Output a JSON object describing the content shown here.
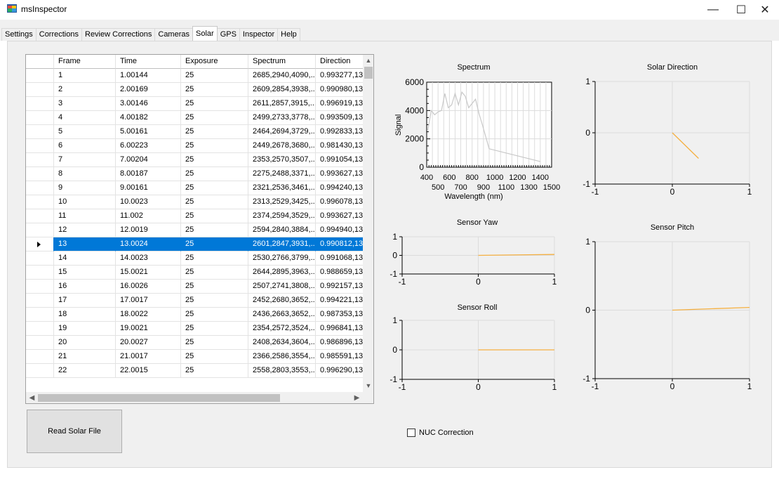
{
  "window": {
    "title": "msInspector",
    "minimize": "—",
    "maximize": "☐",
    "close": "✕"
  },
  "tabs": [
    "Settings",
    "Corrections",
    "Review Corrections",
    "Cameras",
    "Solar",
    "GPS",
    "Inspector",
    "Help"
  ],
  "active_tab": "Solar",
  "grid": {
    "columns": [
      "",
      "Frame",
      "Time",
      "Exposure",
      "Spectrum",
      "Direction"
    ],
    "selected_frame": "13",
    "rows": [
      [
        "1",
        "1.00144",
        "25",
        "2685,2940,4090,...",
        "0.993277,13"
      ],
      [
        "2",
        "2.00169",
        "25",
        "2609,2854,3938,...",
        "0.990980,13"
      ],
      [
        "3",
        "3.00146",
        "25",
        "2611,2857,3915,...",
        "0.996919,13"
      ],
      [
        "4",
        "4.00182",
        "25",
        "2499,2733,3778,...",
        "0.993509,13"
      ],
      [
        "5",
        "5.00161",
        "25",
        "2464,2694,3729,...",
        "0.992833,13"
      ],
      [
        "6",
        "6.00223",
        "25",
        "2449,2678,3680,...",
        "0.981430,13"
      ],
      [
        "7",
        "7.00204",
        "25",
        "2353,2570,3507,...",
        "0.991054,13"
      ],
      [
        "8",
        "8.00187",
        "25",
        "2275,2488,3371,...",
        "0.993627,13"
      ],
      [
        "9",
        "9.00161",
        "25",
        "2321,2536,3461,...",
        "0.994240,13"
      ],
      [
        "10",
        "10.0023",
        "25",
        "2313,2529,3425,...",
        "0.996078,13"
      ],
      [
        "11",
        "11.002",
        "25",
        "2374,2594,3529,...",
        "0.993627,13"
      ],
      [
        "12",
        "12.0019",
        "25",
        "2594,2840,3884,...",
        "0.994940,13"
      ],
      [
        "13",
        "13.0024",
        "25",
        "2601,2847,3931,...",
        "0.990812,13"
      ],
      [
        "14",
        "14.0023",
        "25",
        "2530,2766,3799,...",
        "0.991068,13"
      ],
      [
        "15",
        "15.0021",
        "25",
        "2644,2895,3963,...",
        "0.988659,13"
      ],
      [
        "16",
        "16.0026",
        "25",
        "2507,2741,3808,...",
        "0.992157,13"
      ],
      [
        "17",
        "17.0017",
        "25",
        "2452,2680,3652,...",
        "0.994221,13"
      ],
      [
        "18",
        "18.0022",
        "25",
        "2436,2663,3652,...",
        "0.987353,13"
      ],
      [
        "19",
        "19.0021",
        "25",
        "2354,2572,3524,...",
        "0.996841,13"
      ],
      [
        "20",
        "20.0027",
        "25",
        "2408,2634,3604,...",
        "0.986896,13"
      ],
      [
        "21",
        "21.0017",
        "25",
        "2366,2586,3554,...",
        "0.985591,13"
      ],
      [
        "22",
        "22.0015",
        "25",
        "2558,2803,3553,...",
        "0.996290,13"
      ]
    ]
  },
  "buttons": {
    "read_solar_file": "Read Solar File"
  },
  "nuc_correction": {
    "label": "NUC Correction",
    "checked": false
  },
  "colors": {
    "selection": "#0078d7",
    "chart_line_spectrum": "#c8c8c8",
    "chart_line_orange": "#f5b041",
    "grid_line": "#dcdcdc"
  },
  "chart_data": [
    {
      "type": "line",
      "title": "Spectrum",
      "xlabel": "Wavelength (nm)",
      "ylabel": "Signal",
      "xlim": [
        400,
        1500
      ],
      "ylim": [
        0,
        6000
      ],
      "x_ticks": [
        "400",
        "500",
        "600",
        "700",
        "800",
        "900",
        "1000",
        "1100",
        "1200",
        "1300",
        "1400",
        "1500"
      ],
      "y_ticks": [
        "0",
        "2000",
        "4000",
        "6000"
      ],
      "x": [
        410,
        440,
        470,
        500,
        530,
        560,
        590,
        620,
        650,
        680,
        710,
        740,
        770,
        800,
        830,
        860,
        890,
        950,
        1400
      ],
      "y": [
        2600,
        4000,
        3700,
        3900,
        4000,
        5200,
        4200,
        4400,
        5200,
        4400,
        5300,
        5000,
        4200,
        4500,
        4800,
        3800,
        3000,
        1300,
        400
      ]
    },
    {
      "type": "line",
      "title": "Solar Direction",
      "xlim": [
        -1,
        1
      ],
      "ylim": [
        -1,
        1
      ],
      "x_ticks": [
        "-1",
        "0",
        "1"
      ],
      "y_ticks": [
        "-1",
        "0",
        "1"
      ],
      "x": [
        0,
        0.34
      ],
      "y": [
        0,
        -0.5
      ]
    },
    {
      "type": "line",
      "title": "Sensor Yaw",
      "xlim": [
        -1,
        1
      ],
      "ylim": [
        -1,
        1
      ],
      "x_ticks": [
        "-1",
        "0",
        "1"
      ],
      "y_ticks": [
        "-1",
        "0",
        "1"
      ],
      "x": [
        0,
        1
      ],
      "y": [
        0,
        0.05
      ]
    },
    {
      "type": "line",
      "title": "Sensor Pitch",
      "xlim": [
        -1,
        1
      ],
      "ylim": [
        -1,
        1
      ],
      "x_ticks": [
        "-1",
        "0",
        "1"
      ],
      "y_ticks": [
        "-1",
        "0",
        "1"
      ],
      "x": [
        0,
        1
      ],
      "y": [
        0,
        0.04
      ]
    },
    {
      "type": "line",
      "title": "Sensor Roll",
      "xlim": [
        -1,
        1
      ],
      "ylim": [
        -1,
        1
      ],
      "x_ticks": [
        "-1",
        "0",
        "1"
      ],
      "y_ticks": [
        "-1",
        "0",
        "1"
      ],
      "x": [
        0,
        1
      ],
      "y": [
        0,
        0
      ]
    }
  ]
}
